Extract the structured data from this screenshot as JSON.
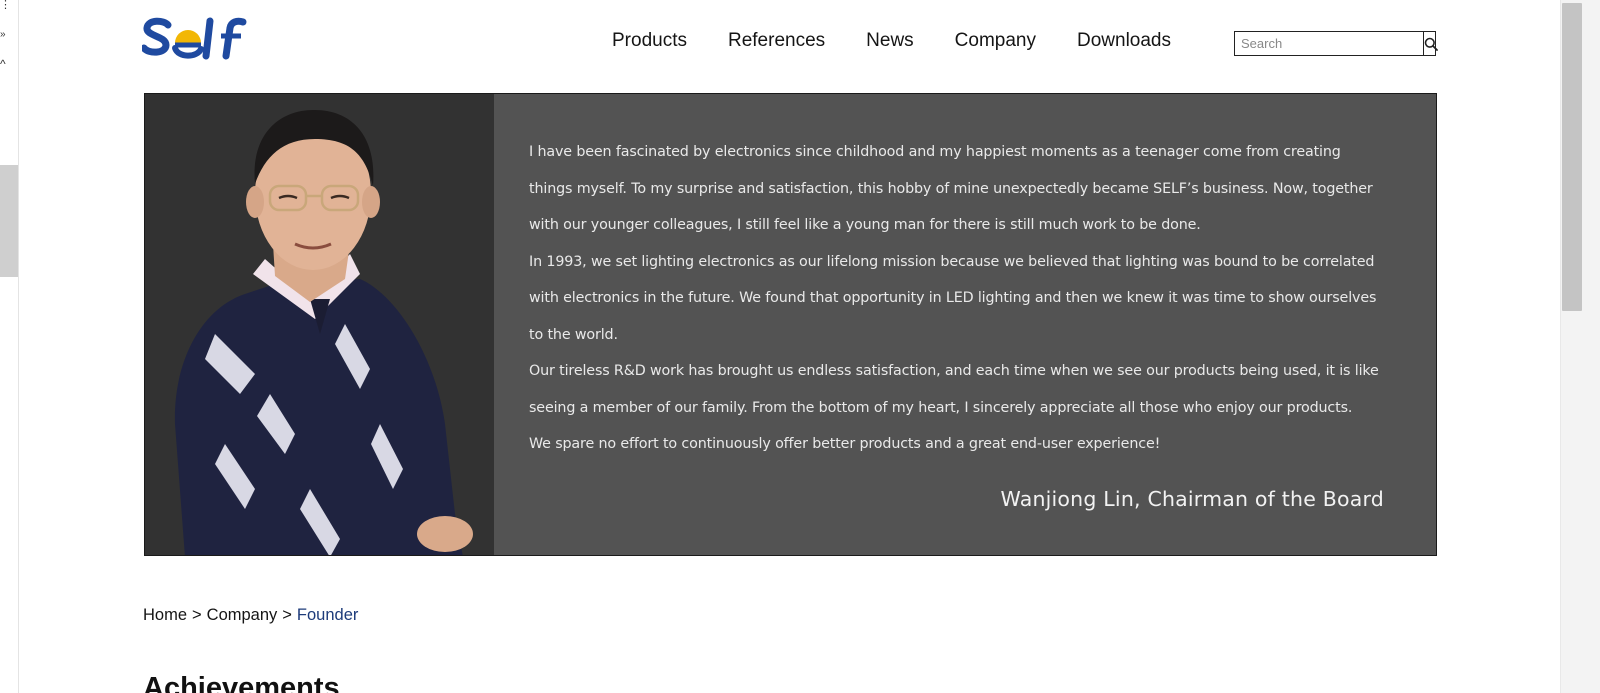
{
  "brand": {
    "logo_text": "SELF",
    "colors": {
      "blue": "#1f4aa0",
      "yellow": "#f2b705"
    }
  },
  "nav": {
    "items": [
      {
        "label": "Products"
      },
      {
        "label": "References"
      },
      {
        "label": "News"
      },
      {
        "label": "Company"
      },
      {
        "label": "Downloads"
      }
    ]
  },
  "search": {
    "placeholder": "Search",
    "value": "",
    "button_icon": "search-icon"
  },
  "banner": {
    "paragraphs": [
      "I have been fascinated by electronics since childhood and my happiest moments as a teenager come from creating",
      "things myself. To my surprise and satisfaction, this hobby of mine unexpectedly became SELF’s business. Now, together",
      "with our younger colleagues, I still feel like a young man for there is still much work to be done.",
      "In 1993, we set lighting electronics as our lifelong mission because we believed that lighting was bound to be correlated",
      "with electronics in the future. We found that opportunity in LED lighting and then we knew it was time to show ourselves",
      "to the world.",
      "Our tireless R&D work has brought us endless satisfaction, and each time when we see our products being used, it is like",
      "seeing a member of our family. From the bottom of my heart, I sincerely appreciate all those who enjoy our products.",
      "We spare no effort to continuously offer better products and a great end-user experience!"
    ],
    "signature": "Wanjiong Lin, Chairman of the Board",
    "colors": {
      "photo_bg": "#323232",
      "text_bg": "#535353"
    }
  },
  "breadcrumb": {
    "home": "Home",
    "company": "Company",
    "current": "Founder",
    "separator": ">"
  },
  "section": {
    "title": "Achievements"
  },
  "browser": {
    "left_glyphs": [
      "⋮",
      "»",
      "^"
    ]
  }
}
